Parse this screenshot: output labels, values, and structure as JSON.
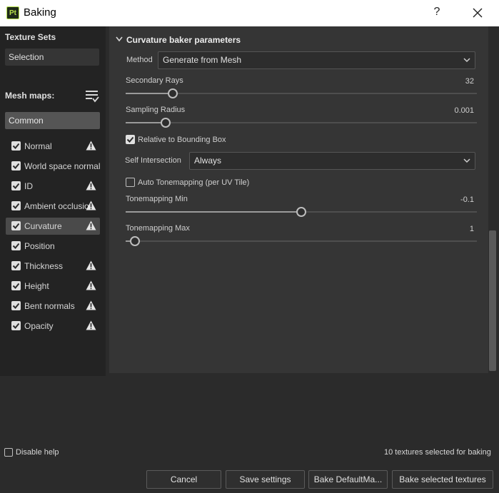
{
  "window": {
    "title": "Baking",
    "app_icon_text": "Pt",
    "help_label": "?"
  },
  "left": {
    "texture_sets_label": "Texture Sets",
    "selection": "Selection",
    "mesh_maps_label": "Mesh maps:",
    "common": "Common",
    "items": [
      {
        "label": "Normal",
        "checked": true,
        "warning": true,
        "active": false
      },
      {
        "label": "World space normal",
        "checked": true,
        "warning": false,
        "active": false
      },
      {
        "label": "ID",
        "checked": true,
        "warning": true,
        "active": false
      },
      {
        "label": "Ambient occlusion",
        "checked": true,
        "warning": true,
        "active": false
      },
      {
        "label": "Curvature",
        "checked": true,
        "warning": true,
        "active": true
      },
      {
        "label": "Position",
        "checked": true,
        "warning": false,
        "active": false
      },
      {
        "label": "Thickness",
        "checked": true,
        "warning": true,
        "active": false
      },
      {
        "label": "Height",
        "checked": true,
        "warning": true,
        "active": false
      },
      {
        "label": "Bent normals",
        "checked": true,
        "warning": true,
        "active": false
      },
      {
        "label": "Opacity",
        "checked": true,
        "warning": true,
        "active": false
      }
    ]
  },
  "main": {
    "section_title": "Curvature baker parameters",
    "method_label": "Method",
    "method_value": "Generate from Mesh",
    "secondary_rays": {
      "label": "Secondary Rays",
      "value": "32",
      "fraction": 0.135
    },
    "sampling_radius": {
      "label": "Sampling Radius",
      "value": "0.001",
      "fraction": 0.113
    },
    "relative_bbox": {
      "label": "Relative to Bounding Box",
      "checked": true
    },
    "self_intersection": {
      "label": "Self Intersection",
      "value": "Always"
    },
    "auto_tonemapping": {
      "label": "Auto Tonemapping (per UV Tile)",
      "checked": false
    },
    "tonemap_min": {
      "label": "Tonemapping Min",
      "value": "-0.1",
      "fraction": 0.5
    },
    "tonemap_max": {
      "label": "Tonemapping Max",
      "value": "1",
      "fraction": 0.026
    }
  },
  "footer": {
    "disable_help": "Disable help",
    "status": "10 textures selected for baking",
    "buttons": {
      "cancel": "Cancel",
      "save": "Save settings",
      "bake_default": "Bake DefaultMa...",
      "bake_selected": "Bake selected textures"
    }
  },
  "colors": {
    "accent_logo": "#b6e04a",
    "panel": "#353535",
    "sidebar": "#232323"
  }
}
